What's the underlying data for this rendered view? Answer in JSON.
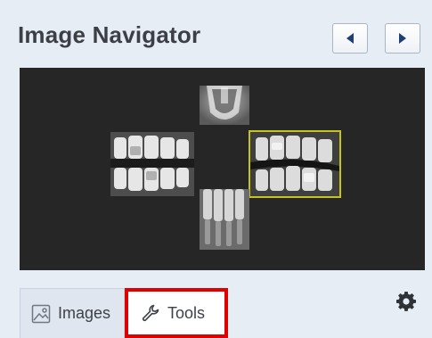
{
  "header": {
    "title": "Image Navigator",
    "prev_icon": "chevron-left-icon",
    "next_icon": "chevron-right-icon"
  },
  "viewer": {
    "background": "#262626",
    "selection_color": "#c8c21f",
    "thumbnails": [
      {
        "name": "top-xray",
        "selected": false
      },
      {
        "name": "left-bitewing-xray",
        "selected": false
      },
      {
        "name": "right-bitewing-xray",
        "selected": true
      },
      {
        "name": "bottom-xray",
        "selected": false
      }
    ]
  },
  "tabs": [
    {
      "label": "Images",
      "icon": "image-icon",
      "active": false
    },
    {
      "label": "Tools",
      "icon": "wrench-icon",
      "active": true,
      "highlight": "#e00000"
    }
  ],
  "settings_icon": "gear-icon"
}
